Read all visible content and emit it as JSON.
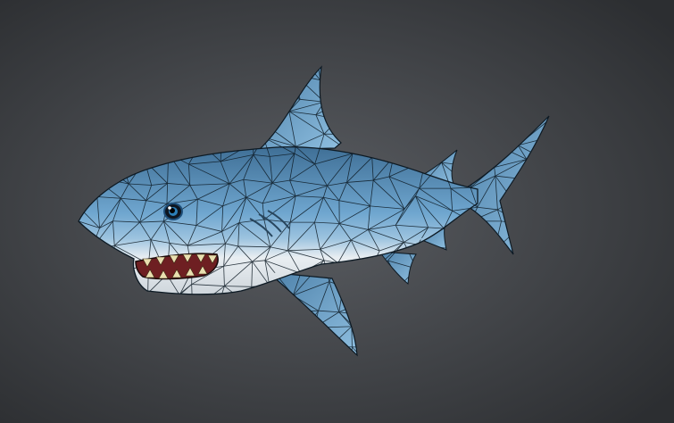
{
  "colors": {
    "background_center": "#5b5e63",
    "background_edge": "#2c2e31",
    "body_top": "#3f6f96",
    "body_mid": "#6fa6cf",
    "belly": "#e9eef2",
    "mouth": "#6e1f22",
    "wire": "#0d1a24"
  }
}
